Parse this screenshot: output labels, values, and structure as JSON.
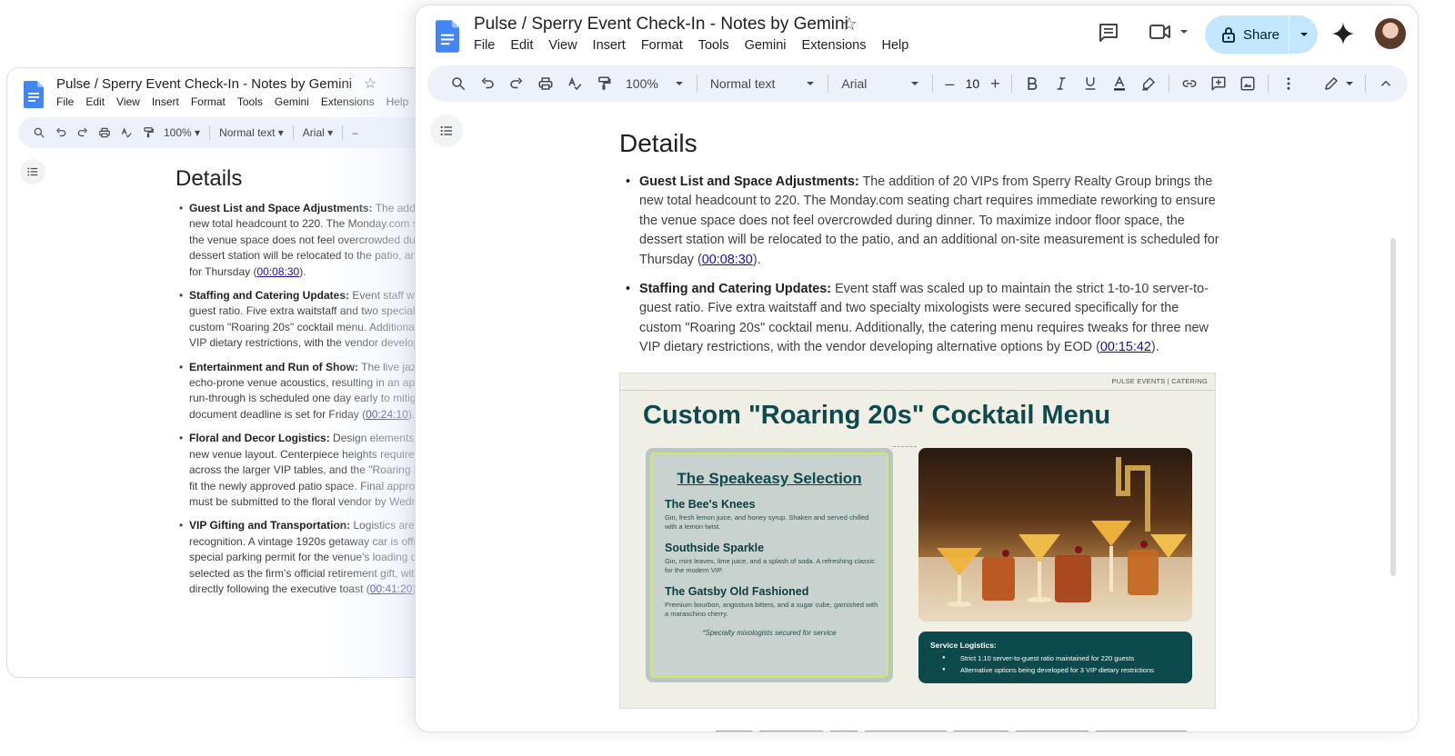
{
  "doc": {
    "title": "Pulse / Sperry Event Check-In - Notes by Gemini",
    "menu": [
      "File",
      "Edit",
      "View",
      "Insert",
      "Format",
      "Tools",
      "Gemini",
      "Extensions",
      "Help"
    ]
  },
  "toolbar": {
    "zoom": "100%",
    "style": "Normal text",
    "font": "Arial",
    "font_size": "10",
    "minus": "–",
    "plus": "+"
  },
  "share": {
    "label": "Share"
  },
  "content": {
    "heading": "Details",
    "bullets": [
      {
        "title": "Guest List and Space Adjustments:",
        "text": " The addition of 20 VIPs from Sperry Realty Group brings the new total headcount to 220. The Monday.com seating chart requires immediate reworking to ensure the venue space does not feel overcrowded during dinner. To maximize indoor floor space, the dessert station will be relocated to the patio, and an additional on-site measurement is scheduled for Thursday (",
        "link": "00:08:30",
        "end": ")."
      },
      {
        "title": "Staffing and Catering Updates:",
        "text": " Event staff was scaled up to maintain the strict 1-to-10 server-to-guest ratio. Five extra waitstaff and two specialty mixologists were secured specifically for the custom \"Roaring 20s\" cocktail menu. Additionally, the catering menu requires tweaks for three new VIP dietary restrictions, with the vendor developing alternative options by EOD (",
        "link": "00:15:42",
        "end": ")."
      }
    ]
  },
  "back_content": {
    "bullets": [
      {
        "title": "Guest List and Space Adjustments:",
        "lines": [
          " The addition",
          "new total headcount to 220. The Monday.com se",
          "the venue space does not feel overcrowded duri",
          "dessert station will be relocated to the patio, and"
        ],
        "last_pre": "for Thursday (",
        "link": "00:08:30",
        "end": ")."
      },
      {
        "title": "Staffing and Catering Updates:",
        "lines": [
          " Event staff was",
          "guest ratio. Five extra waitstaff and two specialt",
          "custom \"Roaring 20s\" cocktail menu. Additionall"
        ],
        "last_pre": "VIP dietary restrictions, with the vendor develop",
        "link": "",
        "end": ""
      },
      {
        "title": "Entertainment and Run of Show:",
        "lines": [
          " The live jazz ba",
          "echo-prone venue acoustics, resulting in an appr",
          "run-through is scheduled one day early to mitiga"
        ],
        "last_pre": "document deadline is set for Friday (",
        "link": "00:24:10",
        "end": ")."
      },
      {
        "title": "Floral and Decor Logistics:",
        "lines": [
          " Design elements req",
          "new venue layout. Centerpiece heights require a",
          "across the larger VIP tables, and the \"Roaring 20",
          "fit the newly approved patio space. Final approva"
        ],
        "last_pre": "must be submitted to the floral vendor by Wedne",
        "link": "",
        "end": ""
      },
      {
        "title": "VIP Gifting and Transportation:",
        "lines": [
          " Logistics are fin",
          "recognition. A vintage 1920s getaway car is offic",
          "special parking permit for the venue's loading do",
          "selected as the firm's official retirement gift, with"
        ],
        "last_pre": "directly following the executive toast (",
        "link": "00:41:20",
        "end": ")."
      }
    ]
  },
  "slide": {
    "tag": "PULSE EVENTS | CATERING",
    "title": "Custom \"Roaring 20s\" Cocktail Menu",
    "menu_heading": "The Speakeasy Selection",
    "items": [
      {
        "name": "The Bee's Knees",
        "desc": "Gin, fresh lemon juice, and honey syrup. Shaken and served chilled with a lemon twist."
      },
      {
        "name": "Southside Sparkle",
        "desc": "Gin, mint leaves, lime juice, and a splash of soda. A refreshing classic for the modern VIP."
      },
      {
        "name": "The Gatsby Old Fashioned",
        "desc": "Premium bourbon, angostura bitters, and a sugar cube, garnished with a maraschino cherry."
      }
    ],
    "note": "*Specialty mixologists secured for service",
    "logistics_title": "Service Logistics:",
    "logistics": [
      "Strict 1:10 server-to-guest ratio maintained for 220 guests",
      "Alternative options being developed for 3 VIP dietary restrictions"
    ]
  },
  "colors": {
    "docs_blue": "#4285f4",
    "share_bg": "#c2e7ff",
    "toolbar_bg": "#edf2fa",
    "slide_teal": "#0e4a4d",
    "link": "#1a0dab"
  },
  "icons": [
    "docs-icon",
    "star-icon",
    "search-icon",
    "undo-icon",
    "redo-icon",
    "print-icon",
    "spellcheck-icon",
    "paint-format-icon",
    "bold-icon",
    "italic-icon",
    "underline-icon",
    "text-color-icon",
    "highlight-icon",
    "link-icon",
    "add-comment-icon",
    "image-icon",
    "more-vert-icon",
    "edit-mode-icon",
    "collapse-icon",
    "outline-icon",
    "comment-icon",
    "meet-icon",
    "lock-icon",
    "gemini-icon"
  ]
}
